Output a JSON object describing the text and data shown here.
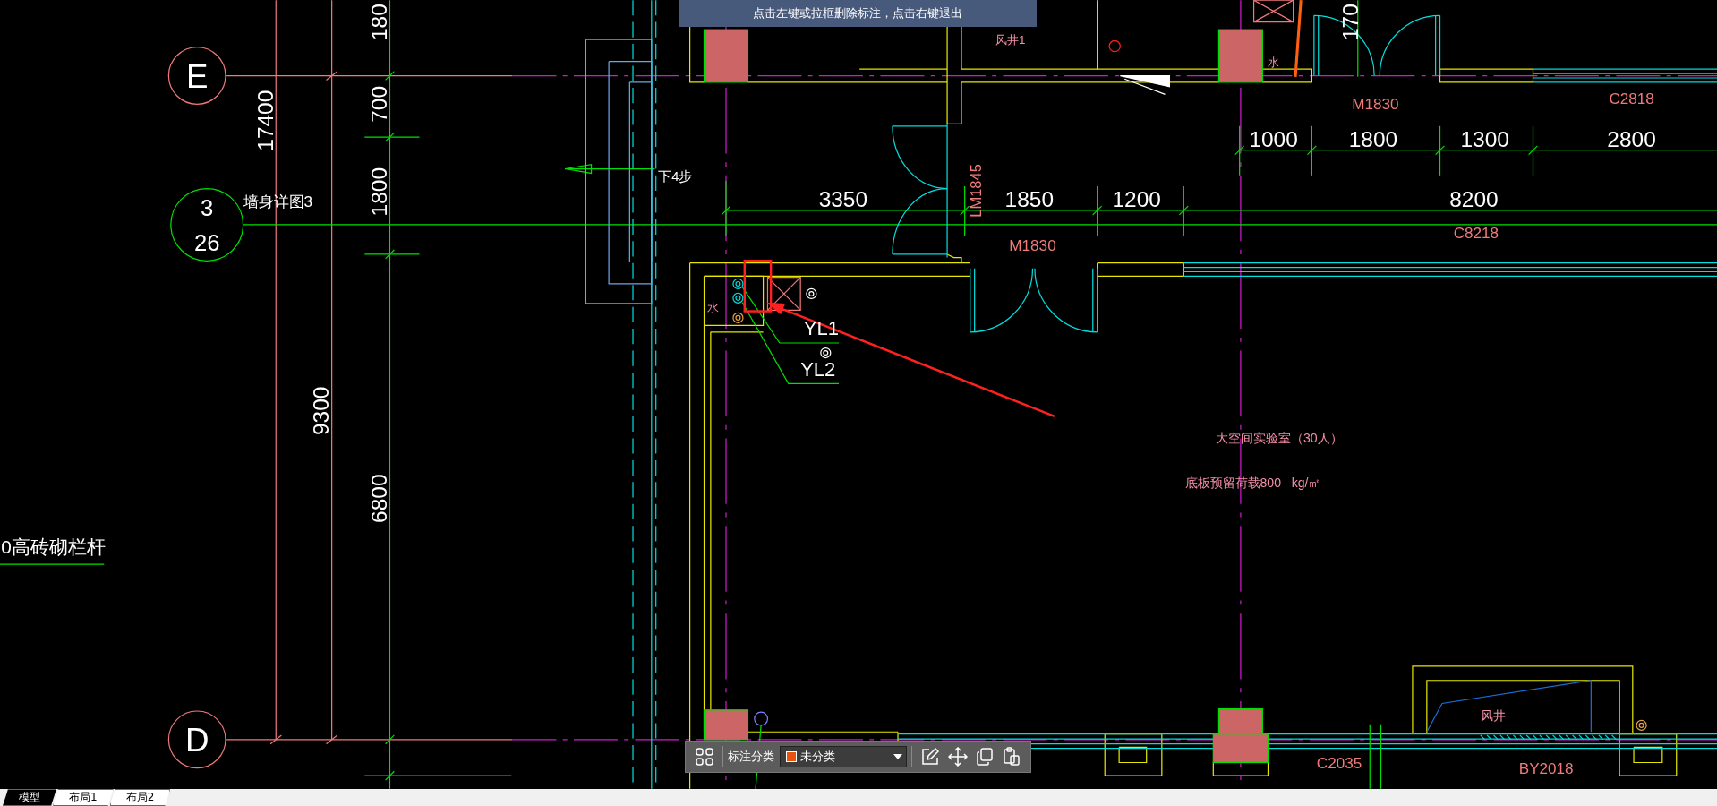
{
  "banner": {
    "text": "点击左键或拉框删除标注，点击右键退出"
  },
  "drawing": {
    "axis_bubbles": [
      {
        "label": "E"
      },
      {
        "label": "D"
      }
    ],
    "detail_bubble": {
      "number": "3",
      "sheet": "26"
    },
    "vertical_dimensions": [
      "17400",
      "9300",
      "180",
      "700",
      "1800",
      "6800",
      "170"
    ],
    "horizontal_dimensions": [
      "1000",
      "1800",
      "1300",
      "2800",
      "3350",
      "1850",
      "1200",
      "8200"
    ],
    "labels": [
      {
        "text": "墙身详图3",
        "kind": "note"
      },
      {
        "text": "下4步",
        "kind": "note"
      },
      {
        "text": "风井1",
        "kind": "room"
      },
      {
        "text": "M1830",
        "kind": "door"
      },
      {
        "text": "C2818",
        "kind": "window"
      },
      {
        "text": "LM1845",
        "kind": "door"
      },
      {
        "text": "M1830",
        "kind": "door"
      },
      {
        "text": "C8218",
        "kind": "window"
      },
      {
        "text": "水",
        "kind": "fixture"
      },
      {
        "text": "水",
        "kind": "fixture"
      },
      {
        "text": "YL1",
        "kind": "pipe"
      },
      {
        "text": "YL2",
        "kind": "pipe"
      },
      {
        "text": "0高砖砌栏杆",
        "kind": "note"
      },
      {
        "text": "大空间实验室（30人）",
        "kind": "room"
      },
      {
        "text": "底板预留荷载800   kg/㎡",
        "kind": "room"
      },
      {
        "text": "风井",
        "kind": "room"
      },
      {
        "text": "C2035",
        "kind": "window"
      },
      {
        "text": "BY2018",
        "kind": "window"
      }
    ]
  },
  "annotation_toolbar": {
    "label": "标注分类",
    "category": "未分类"
  },
  "tabs": [
    {
      "label": "模型",
      "selected": true
    },
    {
      "label": "布局1",
      "selected": false
    },
    {
      "label": "布局2",
      "selected": false
    }
  ]
}
